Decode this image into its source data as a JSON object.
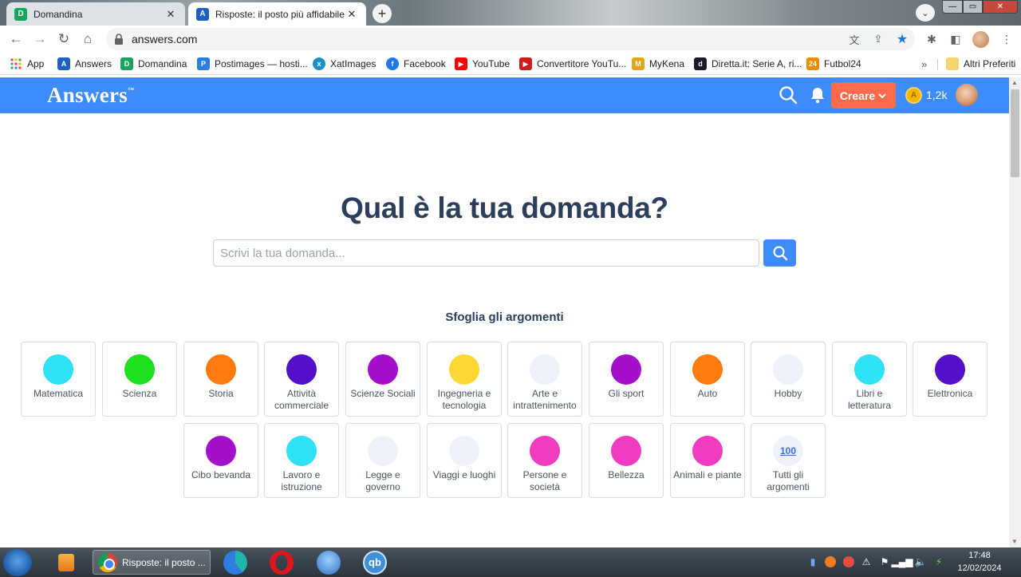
{
  "browser": {
    "tabs": [
      {
        "title": "Domandina",
        "active": false
      },
      {
        "title": "Risposte: il posto più affidabile p",
        "active": true
      }
    ],
    "address": "answers.com",
    "bookmarks": [
      {
        "label": "App"
      },
      {
        "label": "Answers"
      },
      {
        "label": "Domandina"
      },
      {
        "label": "Postimages — hosti..."
      },
      {
        "label": "XatImages"
      },
      {
        "label": "Facebook"
      },
      {
        "label": "YouTube"
      },
      {
        "label": "Convertitore YouTu..."
      },
      {
        "label": "MyKena"
      },
      {
        "label": "Diretta.it: Serie A, ri..."
      },
      {
        "label": "Futbol24"
      }
    ],
    "bookmarks_more": "»",
    "other_bookmarks": "Altri Preferiti"
  },
  "header": {
    "logo": "Answers",
    "logo_tm": "™",
    "create_label": "Creare",
    "coins": "1,2k",
    "accent_color": "#3d8bfd",
    "create_color": "#ff6b4a"
  },
  "main": {
    "title": "Qual è la tua domanda?",
    "search_placeholder": "Scrivi la tua domanda...",
    "browse_title": "Sfoglia gli argomenti",
    "categories": [
      {
        "label": "Matematica",
        "color": "#2ee1f4"
      },
      {
        "label": "Scienza",
        "color": "#1ee01e"
      },
      {
        "label": "Storia",
        "color": "#ff7a0f"
      },
      {
        "label": "Attività commerciale",
        "color": "#5410c9"
      },
      {
        "label": "Scienze Sociali",
        "color": "#a40fcc"
      },
      {
        "label": "Ingegneria e tecnologia",
        "color": "#fdd835"
      },
      {
        "label": "Arte e intrattenimento",
        "color": "#edf2fa"
      },
      {
        "label": "Gli sport",
        "color": "#a40fcc"
      },
      {
        "label": "Auto",
        "color": "#ff7a0f"
      },
      {
        "label": "Hobby",
        "color": "#edf2fa"
      },
      {
        "label": "Libri e letteratura",
        "color": "#2ee1f4"
      },
      {
        "label": "Elettronica",
        "color": "#5410c9"
      },
      {
        "label": "Cibo bevanda",
        "color": "#a40fcc"
      },
      {
        "label": "Lavoro e istruzione",
        "color": "#2ee1f4"
      },
      {
        "label": "Legge e governo",
        "color": "#edf2fa"
      },
      {
        "label": "Viaggi e luoghi",
        "color": "#edf2fa"
      },
      {
        "label": "Persone e società",
        "color": "#f03cc0"
      },
      {
        "label": "Bellezza",
        "color": "#f03cc0"
      },
      {
        "label": "Animali e piante",
        "color": "#f03cc0"
      },
      {
        "label": "Tutti gli argomenti",
        "color": "#edf2fa",
        "badge": "100"
      }
    ]
  },
  "taskbar": {
    "active_window": "Risposte: il posto ...",
    "time": "17:48",
    "date": "12/02/2024"
  }
}
